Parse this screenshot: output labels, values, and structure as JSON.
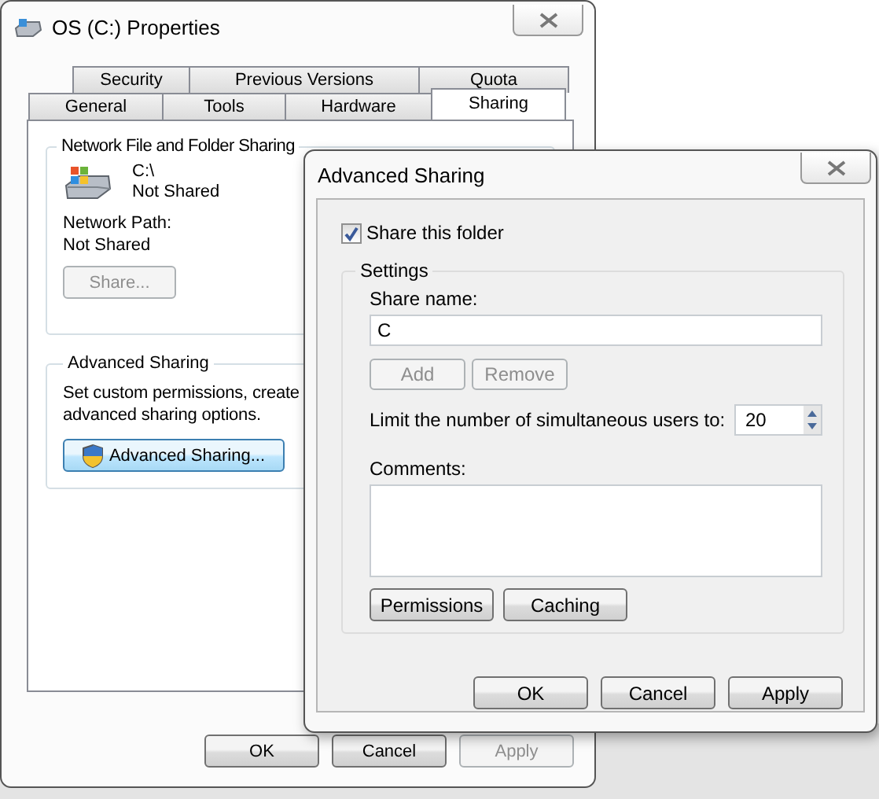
{
  "properties_window": {
    "title": "OS (C:) Properties",
    "tab_rows": [
      [
        {
          "label": "Security",
          "selected": false
        },
        {
          "label": "Previous Versions",
          "selected": false
        },
        {
          "label": "Quota",
          "selected": false
        }
      ],
      [
        {
          "label": "General",
          "selected": false
        },
        {
          "label": "Tools",
          "selected": false
        },
        {
          "label": "Hardware",
          "selected": false
        },
        {
          "label": "Sharing",
          "selected": true
        }
      ]
    ],
    "network_sharing": {
      "heading": "Network File and Folder Sharing",
      "drive": "C:\\",
      "status": "Not Shared",
      "network_path_label": "Network Path:",
      "network_path": "Not Shared",
      "share_button": {
        "label": "Share...",
        "disabled": true
      }
    },
    "advanced_sharing": {
      "heading": "Advanced Sharing",
      "description_lines": [
        "Set custom permissions, create",
        "advanced sharing options."
      ],
      "button": {
        "label": "Advanced Sharing...",
        "disabled": false
      }
    },
    "buttons": [
      {
        "label": "OK",
        "disabled": false
      },
      {
        "label": "Cancel",
        "disabled": false
      },
      {
        "label": "Apply",
        "disabled": true
      }
    ]
  },
  "advanced_dialog": {
    "title": "Advanced Sharing",
    "share_this_folder": {
      "label": "Share this folder",
      "checked": true
    },
    "settings": {
      "heading": "Settings",
      "share_name_label": "Share name:",
      "share_name": "C",
      "name_buttons": [
        {
          "label": "Add",
          "disabled": true
        },
        {
          "label": "Remove",
          "disabled": true
        }
      ],
      "limit_label": "Limit the number of simultaneous users to:",
      "limit_value": "20",
      "comments_label": "Comments:",
      "buttons": [
        {
          "label": "Permissions",
          "disabled": false
        },
        {
          "label": "Caching",
          "disabled": false
        }
      ]
    },
    "buttons": [
      {
        "label": "OK",
        "disabled": false
      },
      {
        "label": "Cancel",
        "disabled": false
      },
      {
        "label": "Apply",
        "disabled": false
      }
    ]
  }
}
